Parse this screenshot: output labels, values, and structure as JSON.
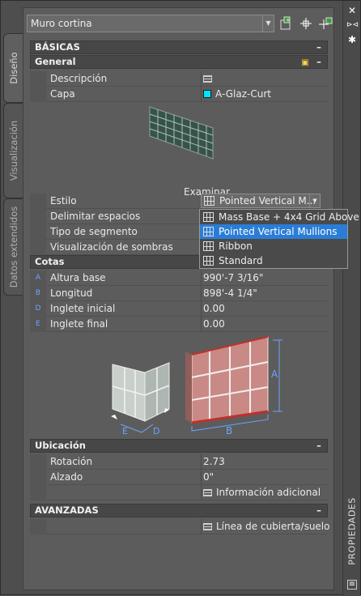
{
  "window": {
    "object_type_value": "Muro cortina",
    "right_strip_label": "PROPIEDADES"
  },
  "left_tabs": [
    "Diseño",
    "Visualización",
    "Datos extendidos"
  ],
  "basicas": {
    "title": "BÁSICAS",
    "general": {
      "title": "General",
      "rows": [
        {
          "label": "Descripción",
          "value": ""
        },
        {
          "label": "Capa",
          "value": "A-Glaz-Curt"
        }
      ],
      "preview_button": "Examinar...",
      "style_rows": [
        {
          "label": "Estilo",
          "value": "Pointed Vertical M..."
        },
        {
          "label": "Delimitar espacios",
          "value": ""
        },
        {
          "label": "Tipo de segmento",
          "value": ""
        },
        {
          "label": "Visualización de sombras",
          "value": ""
        }
      ],
      "style_options": [
        "Mass Base + 4x4 Grid Above",
        "Pointed Vertical Mullions",
        "Ribbon",
        "Standard"
      ],
      "style_selected": "Pointed Vertical Mullions"
    },
    "cotas": {
      "title": "Cotas",
      "rows": [
        {
          "tag": "A",
          "label": "Altura base",
          "value": "990'-7 3/16\""
        },
        {
          "tag": "B",
          "label": "Longitud",
          "value": "898'-4 1/4\""
        },
        {
          "tag": "D",
          "label": "Inglete inicial",
          "value": "0.00"
        },
        {
          "tag": "E",
          "label": "Inglete final",
          "value": "0.00"
        }
      ],
      "diagram_labels": {
        "e": "E",
        "d": "D",
        "a": "A",
        "b": "B"
      }
    },
    "ubicacion": {
      "title": "Ubicación",
      "rows": [
        {
          "label": "Rotación",
          "value": "2.73"
        },
        {
          "label": "Alzado",
          "value": "0\""
        },
        {
          "label": "",
          "value": "Información adicional"
        }
      ]
    }
  },
  "avanzadas": {
    "title": "AVANZADAS",
    "rows": [
      {
        "label": "",
        "value": "Línea de cubierta/suelo"
      }
    ]
  },
  "colors": {
    "accent": "#2a7dd7",
    "layer_swatch": "#00e5ff",
    "dimension_tag": "#6ea3ff"
  }
}
